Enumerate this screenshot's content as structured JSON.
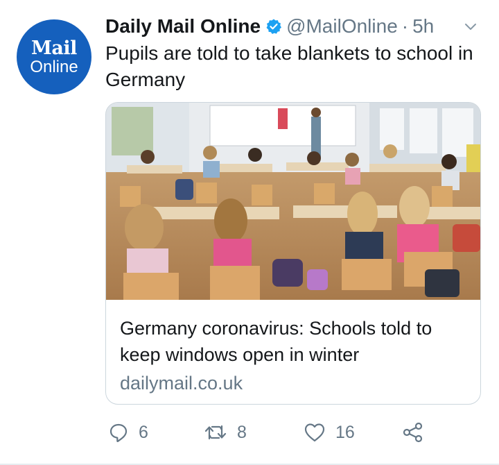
{
  "author": {
    "avatar_line1": "Mail",
    "avatar_line2": "Online",
    "display_name": "Daily Mail Online",
    "verified": true,
    "handle": "@MailOnline",
    "separator": "·",
    "time": "5h"
  },
  "tweet": {
    "text": "Pupils are told to take blankets to school in Germany"
  },
  "card": {
    "image_alt": "classroom photo",
    "title": "Germany coronavirus: Schools told to keep windows open in winter",
    "domain": "dailymail.co.uk"
  },
  "actions": {
    "reply_count": "6",
    "retweet_count": "8",
    "like_count": "16"
  },
  "colors": {
    "avatar_bg": "#1560bd",
    "verified": "#1da1f2",
    "muted": "#657786",
    "text": "#14171a"
  },
  "icons": [
    "verified-badge-icon",
    "chevron-down-icon",
    "reply-icon",
    "retweet-icon",
    "like-icon",
    "share-icon"
  ]
}
